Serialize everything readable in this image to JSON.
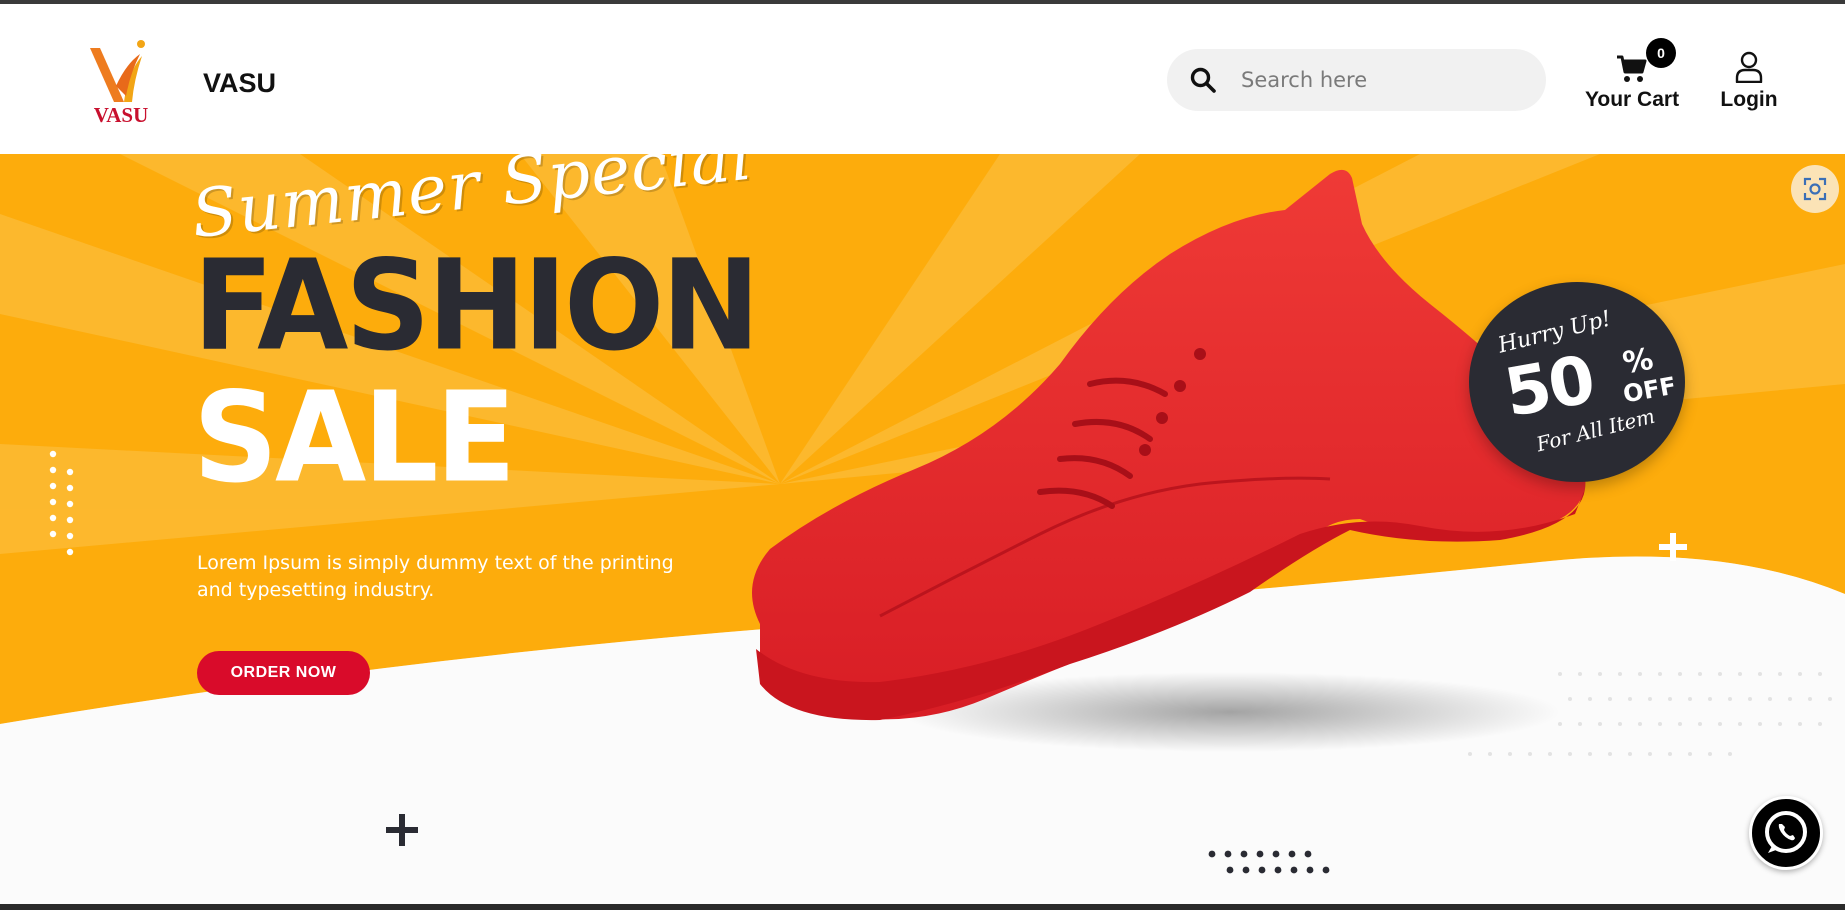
{
  "header": {
    "brand_logo_text": "VASU",
    "brand_name": "VASU",
    "search": {
      "placeholder": "Search here",
      "value": ""
    },
    "cart": {
      "count": "0",
      "label": "Your Cart"
    },
    "login": {
      "label": "Login"
    }
  },
  "hero": {
    "script_title": "Summer Special",
    "headline_line1": "FASHION",
    "headline_line2": "SALE",
    "tagline": "Lorem Ipsum is simply dummy text of the printing and typesetting industry.",
    "cta_label": "ORDER NOW",
    "discount_tag": {
      "hurry": "Hurry Up!",
      "percent": "50",
      "percent_sign": "%",
      "off": "OFF",
      "all_items": "For All Item"
    }
  },
  "colors": {
    "banner_orange": "#fdac0c",
    "headline_dark": "#2a2b33",
    "cta_red": "#d90b2a",
    "shoe_red": "#e8262c",
    "logo_orange": "#ee7c1f",
    "logo_red": "#c8102e"
  },
  "icons": [
    "search-icon",
    "cart-icon",
    "user-icon",
    "scan-icon",
    "whatsapp-icon",
    "plus-icon"
  ]
}
